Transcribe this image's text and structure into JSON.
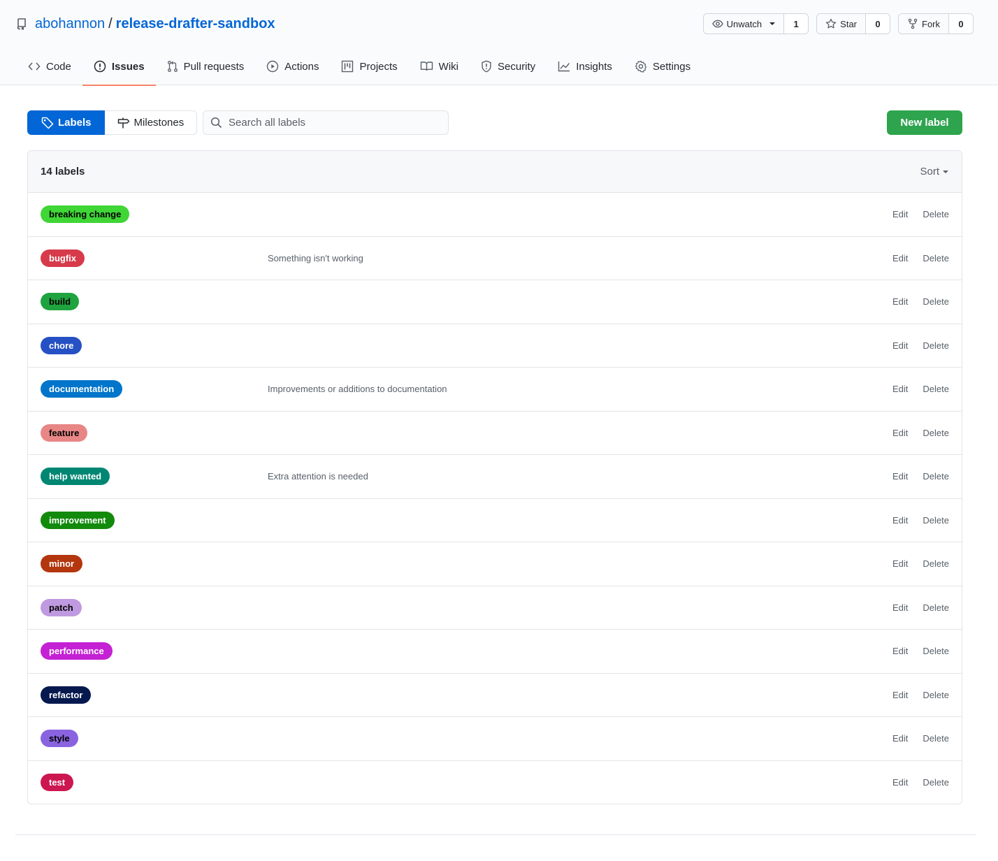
{
  "repo": {
    "owner": "abohannon",
    "separator": "/",
    "name": "release-drafter-sandbox"
  },
  "actions": {
    "watch": {
      "label": "Unwatch",
      "count": "1"
    },
    "star": {
      "label": "Star",
      "count": "0"
    },
    "fork": {
      "label": "Fork",
      "count": "0"
    }
  },
  "nav": {
    "code": "Code",
    "issues": "Issues",
    "pulls": "Pull requests",
    "actions": "Actions",
    "projects": "Projects",
    "wiki": "Wiki",
    "security": "Security",
    "insights": "Insights",
    "settings": "Settings"
  },
  "subnav": {
    "labels": "Labels",
    "milestones": "Milestones",
    "search_placeholder": "Search all labels",
    "new_label": "New label"
  },
  "list": {
    "count": "14 labels",
    "sort": "Sort",
    "edit": "Edit",
    "delete": "Delete",
    "labels": [
      {
        "name": "breaking change",
        "description": "",
        "color": "#3fd636",
        "text_color": "#000000"
      },
      {
        "name": "bugfix",
        "description": "Something isn't working",
        "color": "#d73a4a",
        "text_color": "#ffffff"
      },
      {
        "name": "build",
        "description": "",
        "color": "#1fa33f",
        "text_color": "#000000"
      },
      {
        "name": "chore",
        "description": "",
        "color": "#2651c4",
        "text_color": "#ffffff"
      },
      {
        "name": "documentation",
        "description": "Improvements or additions to documentation",
        "color": "#0075ca",
        "text_color": "#ffffff"
      },
      {
        "name": "feature",
        "description": "",
        "color": "#e88686",
        "text_color": "#000000"
      },
      {
        "name": "help wanted",
        "description": "Extra attention is needed",
        "color": "#008672",
        "text_color": "#ffffff"
      },
      {
        "name": "improvement",
        "description": "",
        "color": "#128a0c",
        "text_color": "#ffffff"
      },
      {
        "name": "minor",
        "description": "",
        "color": "#b3360e",
        "text_color": "#ffffff"
      },
      {
        "name": "patch",
        "description": "",
        "color": "#c09ae0",
        "text_color": "#000000"
      },
      {
        "name": "performance",
        "description": "",
        "color": "#c421d4",
        "text_color": "#ffffff"
      },
      {
        "name": "refactor",
        "description": "",
        "color": "#05194f",
        "text_color": "#ffffff"
      },
      {
        "name": "style",
        "description": "",
        "color": "#8a64e0",
        "text_color": "#000000"
      },
      {
        "name": "test",
        "description": "",
        "color": "#cc1750",
        "text_color": "#ffffff"
      }
    ]
  }
}
